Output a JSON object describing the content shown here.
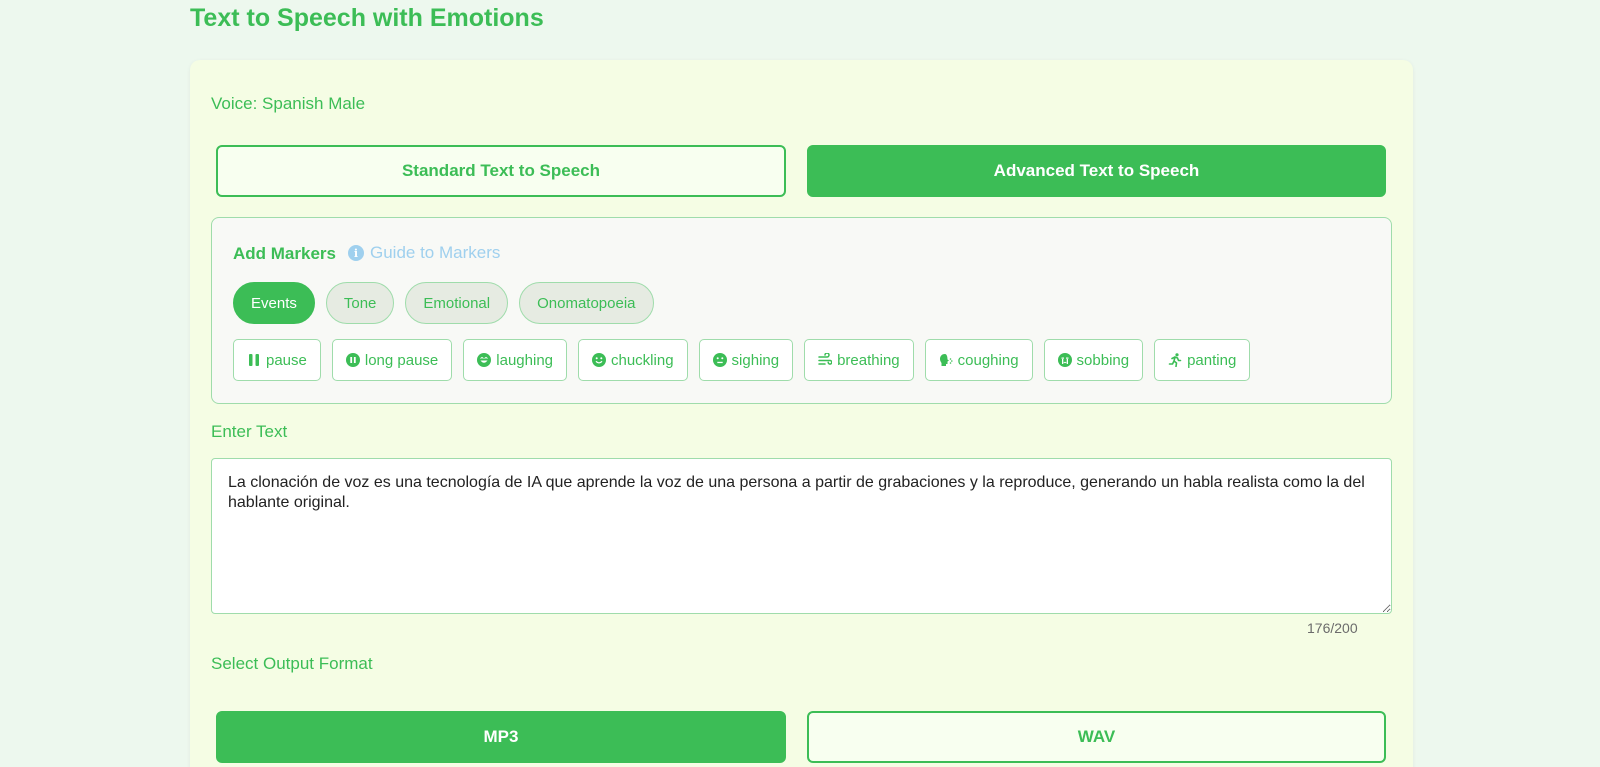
{
  "page": {
    "title": "Text to Speech with Emotions"
  },
  "voice": {
    "label": "Voice: Spanish Male"
  },
  "modes": {
    "standard_label": "Standard Text to Speech",
    "advanced_label": "Advanced Text to Speech",
    "active": "advanced"
  },
  "markers": {
    "title": "Add Markers",
    "guide_label": "Guide to Markers",
    "tabs": [
      {
        "label": "Events",
        "active": true
      },
      {
        "label": "Tone",
        "active": false
      },
      {
        "label": "Emotional",
        "active": false
      },
      {
        "label": "Onomatopoeia",
        "active": false
      }
    ],
    "chips": [
      {
        "label": "pause",
        "icon": "pause-icon"
      },
      {
        "label": "long pause",
        "icon": "pause-circle-icon"
      },
      {
        "label": "laughing",
        "icon": "laughing-face-icon"
      },
      {
        "label": "chuckling",
        "icon": "smiling-face-icon"
      },
      {
        "label": "sighing",
        "icon": "neutral-face-icon"
      },
      {
        "label": "breathing",
        "icon": "wind-icon"
      },
      {
        "label": "coughing",
        "icon": "head-cough-icon"
      },
      {
        "label": "sobbing",
        "icon": "crying-face-icon"
      },
      {
        "label": "panting",
        "icon": "running-person-icon"
      }
    ]
  },
  "input": {
    "label": "Enter Text",
    "value": "La clonación de voz es una tecnología de IA que aprende la voz de una persona a partir de grabaciones y la reproduce, generando un habla realista como la del hablante original.",
    "char_count": "176/200"
  },
  "output_format": {
    "label": "Select Output Format",
    "mp3_label": "MP3",
    "wav_label": "WAV",
    "selected": "MP3"
  },
  "colors": {
    "accent": "#3cbd56",
    "page_bg": "#edf8ee",
    "card_bg": "#f5fde4",
    "guide_link": "#9fd0ee"
  }
}
